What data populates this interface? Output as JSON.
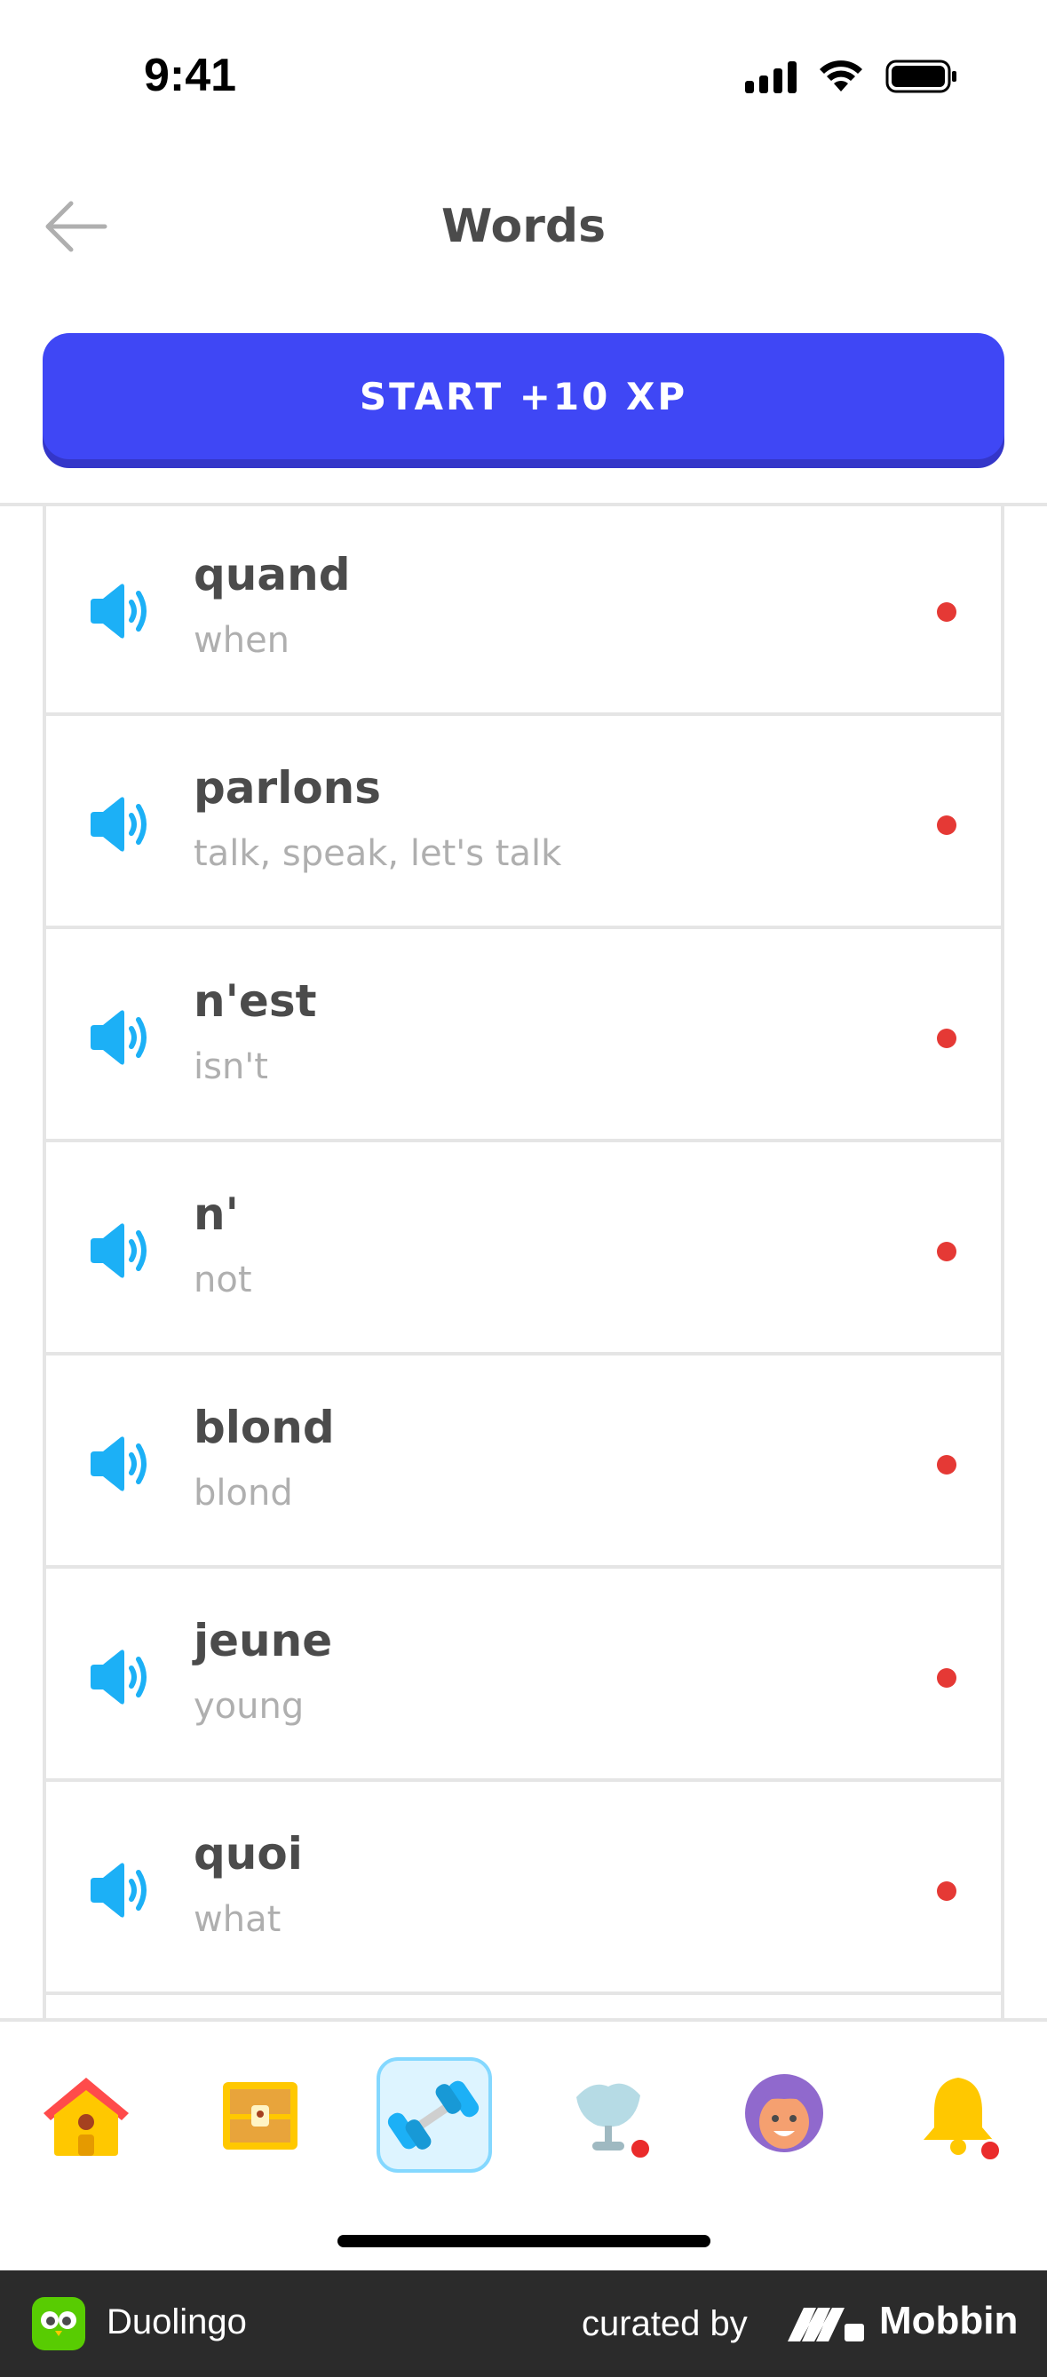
{
  "status_bar": {
    "time": "9:41"
  },
  "header": {
    "title": "Words"
  },
  "start_button": {
    "label": "START +10 XP"
  },
  "words": [
    {
      "word": "quand",
      "translation": "when"
    },
    {
      "word": "parlons",
      "translation": "talk, speak, let's talk"
    },
    {
      "word": "n'est",
      "translation": "isn't"
    },
    {
      "word": "n'",
      "translation": "not"
    },
    {
      "word": "blond",
      "translation": "blond"
    },
    {
      "word": "jeune",
      "translation": "young"
    },
    {
      "word": "quoi",
      "translation": "what"
    }
  ],
  "bottom_nav": {
    "items": [
      {
        "icon": "home-icon"
      },
      {
        "icon": "treasure-chest-icon"
      },
      {
        "icon": "dumbbell-icon",
        "active": true
      },
      {
        "icon": "shield-icon",
        "badge": true
      },
      {
        "icon": "profile-avatar-icon"
      },
      {
        "icon": "bell-icon",
        "badge": true
      }
    ]
  },
  "footer": {
    "app_name": "Duolingo",
    "curated_by": "curated by",
    "brand": "Mobbin"
  },
  "colors": {
    "primary": "#3f47f5",
    "speaker_blue": "#1cb0f6",
    "dot_red": "#e53935",
    "text_dark": "#4b4b4b",
    "text_light": "#afafaf"
  }
}
